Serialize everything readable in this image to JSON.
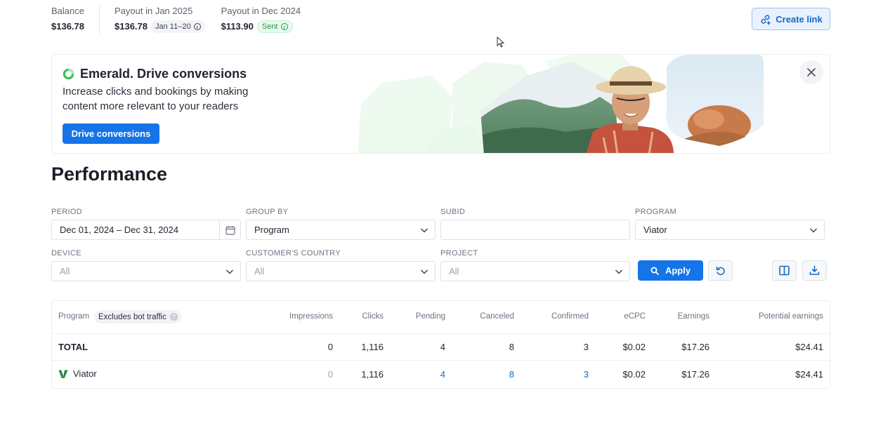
{
  "colors": {
    "accent": "#1574e8",
    "link": "#1668c7",
    "sent": "#1e9b44",
    "emerald": "#3ec45a",
    "viator_green": "#1f8a3e"
  },
  "stats": {
    "balance_label": "Balance",
    "balance_value": "$136.78",
    "jan_label": "Payout in Jan 2025",
    "jan_value": "$136.78",
    "jan_badge": "Jan 11–20",
    "dec_label": "Payout in Dec 2024",
    "dec_value": "$113.90",
    "dec_badge": "Sent"
  },
  "header": {
    "create_link_label": "Create link",
    "create_link_icon": "link-plus-icon"
  },
  "banner": {
    "title": "Emerald. Drive conversions",
    "text": "Increase clicks and bookings by making content more relevant to your readers",
    "button_label": "Drive conversions",
    "close_icon": "close-icon"
  },
  "performance": {
    "title": "Performance",
    "filters": {
      "period_label": "PERIOD",
      "period_value": "Dec 01, 2024 – Dec 31, 2024",
      "group_by_label": "GROUP BY",
      "group_by_value": "Program",
      "subid_label": "SUBID",
      "subid_value": "",
      "program_label": "PROGRAM",
      "program_value": "Viator",
      "device_label": "DEVICE",
      "device_value": "All",
      "country_label": "CUSTOMER'S COUNTRY",
      "country_value": "All",
      "project_label": "PROJECT",
      "project_value": "All",
      "apply_label": "Apply"
    },
    "table": {
      "headers": {
        "program": "Program",
        "badge": "Excludes bot traffic",
        "impressions": "Impressions",
        "clicks": "Clicks",
        "pending": "Pending",
        "canceled": "Canceled",
        "confirmed": "Confirmed",
        "ecpc": "eCPC",
        "earnings": "Earnings",
        "potential": "Potential earnings"
      },
      "total": {
        "label": "TOTAL",
        "impressions": "0",
        "clicks": "1,116",
        "pending": "4",
        "canceled": "8",
        "confirmed": "3",
        "ecpc": "$0.02",
        "earnings": "$17.26",
        "potential": "$24.41"
      },
      "rows": [
        {
          "program": "Viator",
          "impressions": "0",
          "clicks": "1,116",
          "pending": "4",
          "canceled": "8",
          "confirmed": "3",
          "ecpc": "$0.02",
          "earnings": "$17.26",
          "potential": "$24.41"
        }
      ]
    }
  }
}
